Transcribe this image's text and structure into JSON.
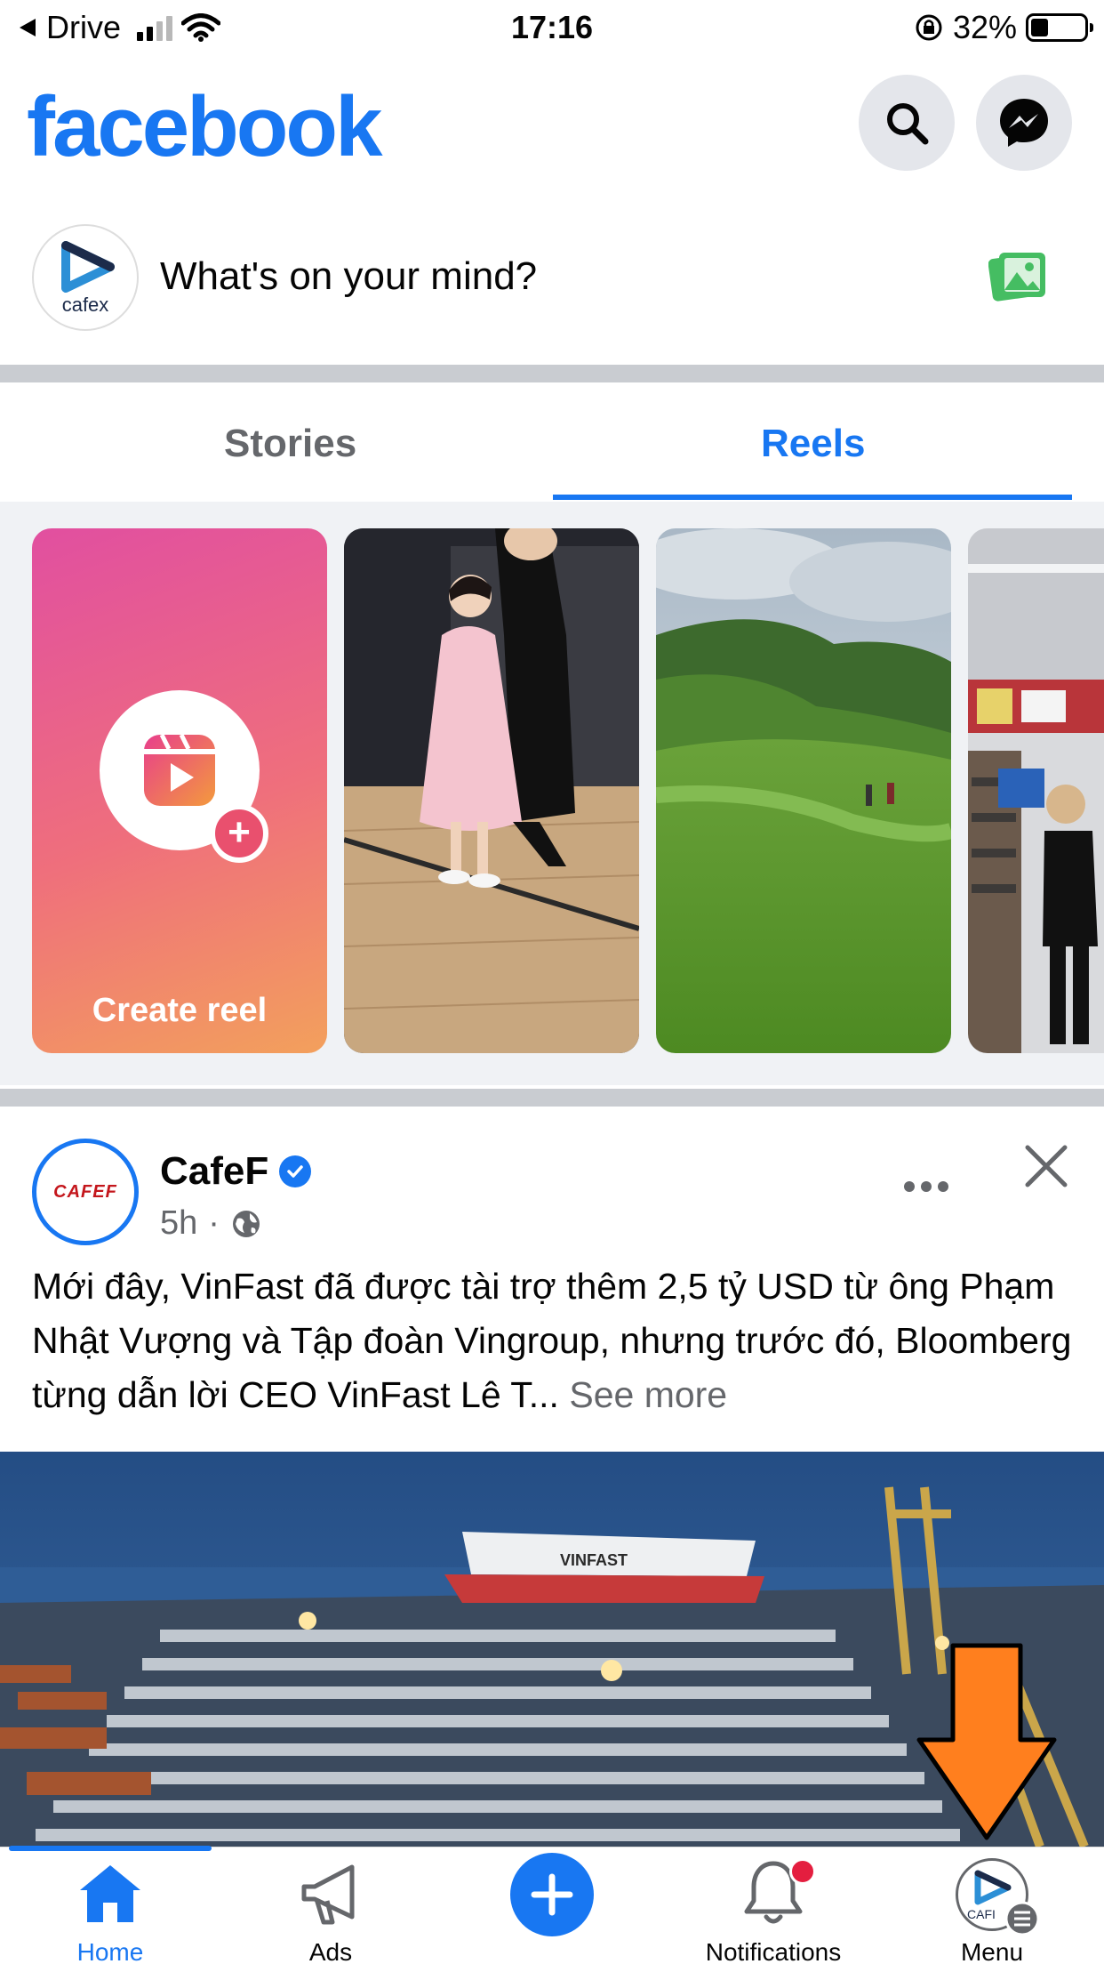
{
  "status_bar": {
    "back_app": "Drive",
    "time": "17:16",
    "battery_percent": "32%",
    "battery_level": 0.32
  },
  "header": {
    "logo": "facebook"
  },
  "composer": {
    "avatar_text": "cafex",
    "placeholder": "What's on your mind?"
  },
  "tabs": {
    "stories": "Stories",
    "reels": "Reels",
    "active": "Reels"
  },
  "reels": {
    "create_label": "Create reel"
  },
  "post": {
    "avatar_text": "CAFEF",
    "author": "CafeF",
    "time": "5h",
    "separator": "·",
    "text": "Mới đây, VinFast đã được tài trợ thêm 2,5 tỷ USD từ ông Phạm Nhật Vượng và Tập đoàn Vingroup, nhưng trước đó, Bloomberg từng dẫn lời CEO VinFast Lê T...",
    "see_more": "See more",
    "ship_text": "VINFAST"
  },
  "bottom_nav": {
    "items": [
      {
        "label": "Home"
      },
      {
        "label": "Ads"
      },
      {
        "label": "Notifications"
      },
      {
        "label": "Menu"
      }
    ],
    "menu_avatar_text": "CAFI"
  },
  "colors": {
    "brand": "#1877f2",
    "annotation_arrow": "#ff7f1e",
    "notification_dot": "#e41e3f"
  }
}
